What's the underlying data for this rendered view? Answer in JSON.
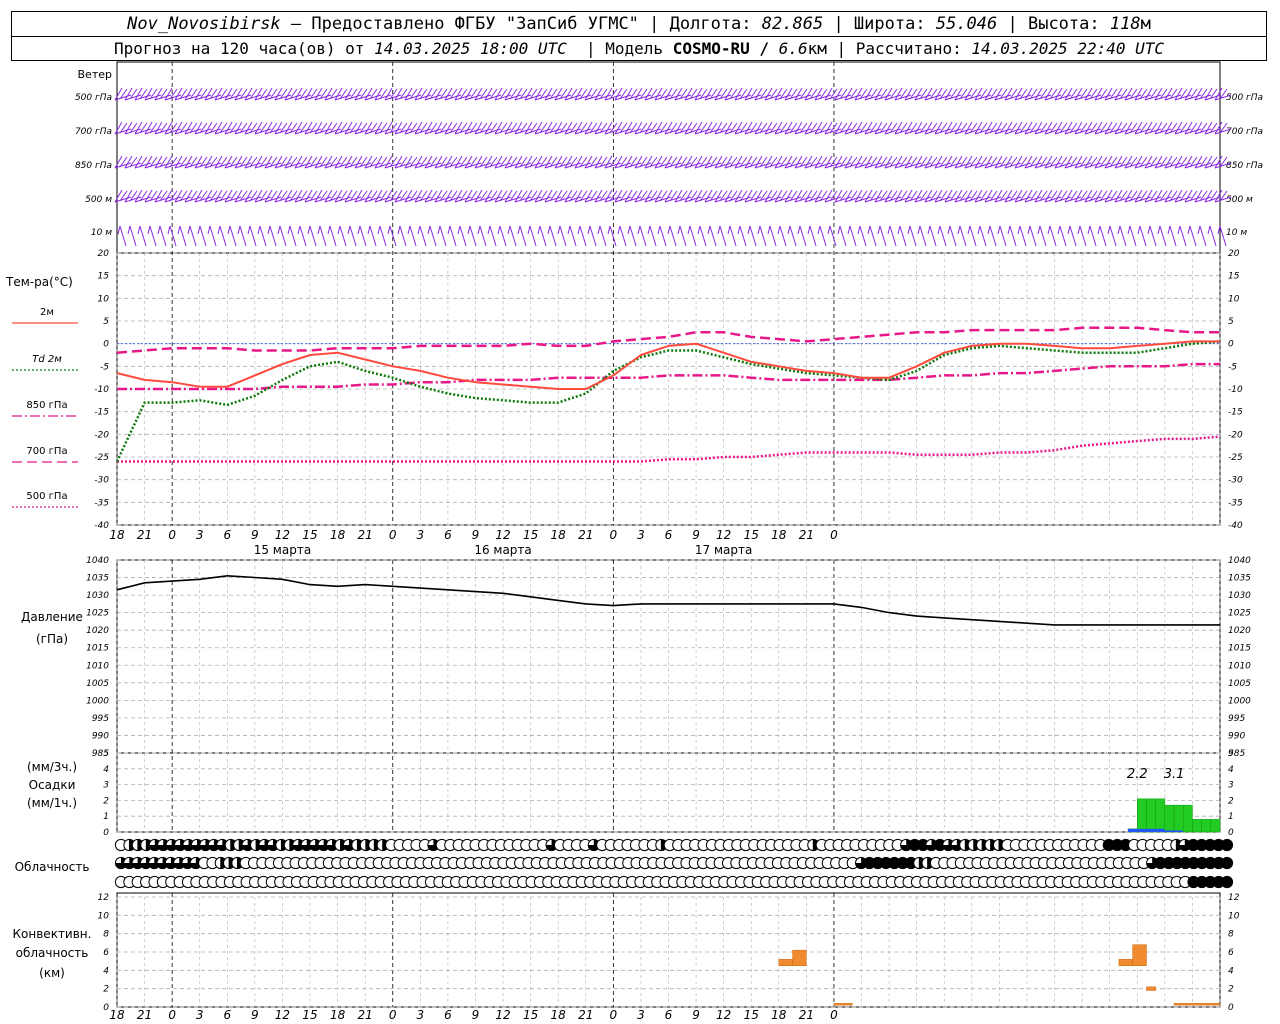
{
  "header": {
    "station": "Nov_Novosibirsk",
    "provider_text": "– Предоставлено ФГБУ \"ЗапСиб УГМС\"",
    "lon_label": "Долгота:",
    "lon_value": "82.865",
    "lat_label": "Широта:",
    "lat_value": "55.046",
    "alt_label": "Высота:",
    "alt_value": "118",
    "alt_unit": "м",
    "forecast_label": "Прогноз на 120 часа(ов) от",
    "forecast_time": "14.03.2025 18:00 UTC",
    "model_label": "Модель",
    "model_name": "COSMO-RU /",
    "model_res": "6.6",
    "model_res_unit": "км",
    "calc_label": "Рассчитано:",
    "calc_time": "14.03.2025 22:40 UTC"
  },
  "colors": {
    "wind": "#8a2be2",
    "t2m": "#ff4a3d",
    "td2m": "#0a7a0a",
    "t850": "#e8188a",
    "t700": "#e8188a",
    "t500": "#e8188a",
    "pressure": "#000000",
    "precip": "#22cc22",
    "precip_1h": "#2255ff",
    "convective": "#f08a30",
    "grid": "#b0b0b0"
  },
  "chart_data": [
    {
      "type": "wind_barbs",
      "title": "Ветер",
      "levels": [
        "500 гПа",
        "700 гПа",
        "850 гПа",
        "500 м",
        "10 м"
      ]
    },
    {
      "type": "line",
      "title": "Тем-ра(°C)",
      "ylim": [
        -40,
        20
      ],
      "yticks": [
        20,
        15,
        10,
        5,
        0,
        -5,
        -10,
        -15,
        -20,
        -25,
        -30,
        -35,
        -40
      ],
      "x_hours": [
        0,
        3,
        6,
        9,
        12,
        15,
        18,
        21,
        24,
        27,
        30,
        33,
        36,
        39,
        42,
        45,
        48,
        51,
        54,
        57,
        60,
        63,
        66,
        69,
        72,
        75,
        78,
        81,
        84,
        87,
        90,
        93,
        96,
        99,
        102,
        105,
        108,
        111,
        114,
        117,
        120
      ],
      "x_tick_labels": [
        "18",
        "21",
        "0",
        "3",
        "6",
        "9",
        "12",
        "15",
        "18",
        "21",
        "0",
        "3",
        "6",
        "9",
        "12",
        "15",
        "18",
        "21",
        "0",
        "3",
        "6",
        "9",
        "12",
        "15",
        "18",
        "21",
        "0"
      ],
      "date_labels": [
        {
          "hour": 18,
          "text": "15 марта"
        },
        {
          "hour": 42,
          "text": "16 марта"
        },
        {
          "hour": 66,
          "text": "17 марта"
        }
      ],
      "series": [
        {
          "name": "2м",
          "style": "solid",
          "values": [
            -6.5,
            -8,
            -8.5,
            -9.5,
            -9.5,
            -7,
            -4.5,
            -2.5,
            -2,
            -3.5,
            -5,
            -6,
            -7.5,
            -8.5,
            -9,
            -9.5,
            -10,
            -10,
            -7,
            -2.5,
            -0.5,
            0,
            -2,
            -4,
            -5,
            -6,
            -6.5,
            -7.5,
            -7.5,
            -5,
            -2,
            -0.5,
            0,
            0,
            -0.5,
            -1,
            -1,
            -0.5,
            0,
            0.5,
            0.5
          ]
        },
        {
          "name": "Td 2м",
          "style": "dotted",
          "values": [
            -26,
            -13,
            -13,
            -12.5,
            -13.5,
            -11.5,
            -8,
            -5,
            -4,
            -6,
            -7.5,
            -9.5,
            -11,
            -12,
            -12.5,
            -13,
            -13,
            -11,
            -6,
            -3,
            -1.5,
            -1.5,
            -3,
            -4.5,
            -5.5,
            -6.5,
            -7,
            -7.5,
            -8,
            -6,
            -2.5,
            -1,
            -0.5,
            -1,
            -1.5,
            -2,
            -2,
            -2,
            -1,
            0,
            0.5
          ]
        },
        {
          "name": "850 гПа",
          "style": "dashdot",
          "values": [
            -10,
            -10,
            -10,
            -10,
            -10,
            -10,
            -9.5,
            -9.5,
            -9.5,
            -9,
            -9,
            -8.5,
            -8.5,
            -8,
            -8,
            -8,
            -7.5,
            -7.5,
            -7.5,
            -7.5,
            -7,
            -7,
            -7,
            -7.5,
            -8,
            -8,
            -8,
            -8,
            -8,
            -7.5,
            -7,
            -7,
            -6.5,
            -6.5,
            -6,
            -5.5,
            -5,
            -5,
            -5,
            -4.5,
            -4.5
          ]
        },
        {
          "name": "700 гПа",
          "style": "dashed",
          "values": [
            -2,
            -1.5,
            -1,
            -1,
            -1,
            -1.5,
            -1.5,
            -1.5,
            -1,
            -1,
            -1,
            -0.5,
            -0.5,
            -0.5,
            -0.5,
            0,
            -0.5,
            -0.5,
            0.5,
            1,
            1.5,
            2.5,
            2.5,
            1.5,
            1,
            0.5,
            1,
            1.5,
            2,
            2.5,
            2.5,
            3,
            3,
            3,
            3,
            3.5,
            3.5,
            3.5,
            3,
            2.5,
            2.5
          ]
        },
        {
          "name": "500 гПа",
          "style": "dotted",
          "values": [
            -26,
            -26,
            -26,
            -26,
            -26,
            -26,
            -26,
            -26,
            -26,
            -26,
            -26,
            -26,
            -26,
            -26,
            -26,
            -26,
            -26,
            -26,
            -26,
            -26,
            -25.5,
            -25.5,
            -25,
            -25,
            -24.5,
            -24,
            -24,
            -24,
            -24,
            -24.5,
            -24.5,
            -24.5,
            -24,
            -24,
            -23.5,
            -22.5,
            -22,
            -21.5,
            -21,
            -21,
            -20.5
          ]
        }
      ]
    },
    {
      "type": "line",
      "title": "Давление",
      "ylabel": "(гПа)",
      "ylim": [
        985,
        1040
      ],
      "yticks": [
        1040,
        1035,
        1030,
        1025,
        1020,
        1015,
        1010,
        1005,
        1000,
        995,
        990,
        985
      ],
      "series": [
        {
          "name": "Давление",
          "values": [
            1031.5,
            1033.5,
            1034,
            1034.5,
            1035.5,
            1035,
            1034.5,
            1033,
            1032.5,
            1033,
            1032.5,
            1032,
            1031.5,
            1031,
            1030.5,
            1029.5,
            1028.5,
            1027.5,
            1027,
            1027.5,
            1027.5,
            1027.5,
            1027.5,
            1027.5,
            1027.5,
            1027.5,
            1027.5,
            1026.5,
            1025,
            1024,
            1023.5,
            1023,
            1022.5,
            1022,
            1021.5,
            1021.5,
            1021.5,
            1021.5,
            1021.5,
            1021.5,
            1021.5
          ]
        }
      ]
    },
    {
      "type": "bar",
      "title": "Осадки",
      "ylabel_top": "(мм/3ч.)",
      "ylabel_bottom": "(мм/1ч.)",
      "ylim": [
        0,
        5
      ],
      "yticks": [
        5,
        4,
        3,
        2,
        1,
        0
      ],
      "bars_hour_start": [
        108,
        109,
        110,
        111,
        112,
        113,
        114,
        115,
        116,
        117,
        118,
        119
      ],
      "values": [
        0,
        0,
        0.2,
        2.1,
        2.1,
        2.1,
        1.7,
        1.7,
        1.7,
        0.8,
        0.8,
        0.8
      ],
      "values_1h": [
        0,
        0,
        0.2,
        0.2,
        0.2,
        0.2,
        0.1,
        0.1,
        0,
        0,
        0,
        0
      ],
      "totals": [
        {
          "hour": 111,
          "text": "2.2"
        },
        {
          "hour": 115,
          "text": "3.1"
        }
      ]
    },
    {
      "type": "table",
      "title": "Облачность",
      "rows": [
        "low",
        "mid",
        "high"
      ],
      "rows_octas": [
        [
          0,
          4,
          4,
          4,
          6,
          6,
          6,
          6,
          6,
          6,
          6,
          6,
          6,
          4,
          4,
          6,
          4,
          6,
          6,
          4,
          4,
          6,
          6,
          6,
          6,
          6,
          4,
          6,
          4,
          4,
          4,
          4,
          0,
          0,
          0,
          0,
          0,
          6,
          0,
          0,
          0,
          0,
          0,
          0,
          0,
          0,
          0,
          0,
          0,
          0,
          0,
          6,
          0,
          0,
          0,
          0,
          6,
          0,
          0,
          0,
          0,
          0,
          0,
          0,
          4,
          0,
          0,
          0,
          0,
          0,
          0,
          0,
          0,
          0,
          0,
          0,
          0,
          0,
          0,
          0,
          0,
          0,
          4,
          0,
          0,
          0,
          0,
          0,
          0,
          0,
          0,
          0,
          0,
          6,
          8,
          8,
          6,
          8,
          6,
          6,
          4,
          4,
          4,
          4,
          4,
          0,
          0,
          0,
          0,
          0,
          0,
          0,
          0,
          0,
          0,
          0,
          0,
          8,
          8,
          8,
          0,
          0,
          0,
          0,
          0,
          4,
          6,
          8,
          8,
          8,
          8,
          8
        ],
        [
          6,
          6,
          6,
          6,
          6,
          6,
          6,
          6,
          6,
          6,
          0,
          0,
          4,
          4,
          4,
          0,
          0,
          0,
          0,
          0,
          0,
          0,
          0,
          0,
          0,
          0,
          0,
          0,
          0,
          0,
          0,
          0,
          0,
          0,
          0,
          0,
          0,
          0,
          0,
          0,
          0,
          0,
          0,
          0,
          0,
          0,
          0,
          0,
          0,
          0,
          0,
          0,
          0,
          0,
          0,
          0,
          0,
          0,
          0,
          0,
          0,
          0,
          0,
          0,
          0,
          0,
          0,
          0,
          0,
          0,
          0,
          0,
          0,
          0,
          0,
          0,
          0,
          0,
          0,
          0,
          0,
          0,
          0,
          0,
          0,
          0,
          0,
          0,
          0,
          6,
          8,
          8,
          8,
          8,
          8,
          8,
          4,
          4,
          0,
          0,
          0,
          0,
          0,
          0,
          0,
          0,
          0,
          0,
          0,
          0,
          0,
          0,
          0,
          0,
          0,
          0,
          0,
          0,
          0,
          0,
          0,
          0,
          0,
          0,
          6,
          8,
          8,
          8,
          8,
          8,
          8,
          8,
          8,
          8
        ],
        [
          0,
          0,
          0,
          0,
          0,
          0,
          0,
          0,
          0,
          0,
          0,
          0,
          0,
          0,
          0,
          0,
          0,
          0,
          0,
          0,
          0,
          0,
          0,
          0,
          0,
          0,
          0,
          0,
          0,
          0,
          0,
          0,
          0,
          0,
          0,
          0,
          0,
          0,
          0,
          0,
          0,
          0,
          0,
          0,
          0,
          0,
          0,
          0,
          0,
          0,
          0,
          0,
          0,
          0,
          0,
          0,
          0,
          0,
          0,
          0,
          0,
          0,
          0,
          0,
          0,
          0,
          0,
          0,
          0,
          0,
          0,
          0,
          0,
          0,
          0,
          0,
          0,
          0,
          0,
          0,
          0,
          0,
          0,
          0,
          0,
          0,
          0,
          0,
          0,
          0,
          0,
          0,
          0,
          0,
          0,
          0,
          0,
          0,
          0,
          0,
          0,
          0,
          0,
          0,
          0,
          0,
          0,
          0,
          0,
          0,
          0,
          0,
          0,
          0,
          0,
          0,
          0,
          0,
          0,
          0,
          0,
          0,
          0,
          0,
          0,
          0,
          0,
          0,
          8,
          8,
          8,
          8,
          8
        ]
      ]
    },
    {
      "type": "bar",
      "title": "Конвективн. облачность",
      "ylabel": "(км)",
      "ylim": [
        0,
        12
      ],
      "yticks": [
        12,
        10,
        8,
        6,
        4,
        2,
        0
      ],
      "bars": [
        {
          "hour_start": 72,
          "hour_end": 73.5,
          "bottom": 4.5,
          "top": 5.2
        },
        {
          "hour_start": 73.5,
          "hour_end": 75,
          "bottom": 4.5,
          "top": 6.2
        },
        {
          "hour_start": 78,
          "hour_end": 80,
          "bottom": 0.2,
          "top": 0.4
        },
        {
          "hour_start": 109,
          "hour_end": 110.5,
          "bottom": 4.5,
          "top": 5.2
        },
        {
          "hour_start": 110.5,
          "hour_end": 112,
          "bottom": 4.5,
          "top": 6.8
        },
        {
          "hour_start": 112,
          "hour_end": 113,
          "bottom": 1.8,
          "top": 2.2
        },
        {
          "hour_start": 115,
          "hour_end": 120,
          "bottom": 0.2,
          "top": 0.4
        }
      ]
    }
  ]
}
